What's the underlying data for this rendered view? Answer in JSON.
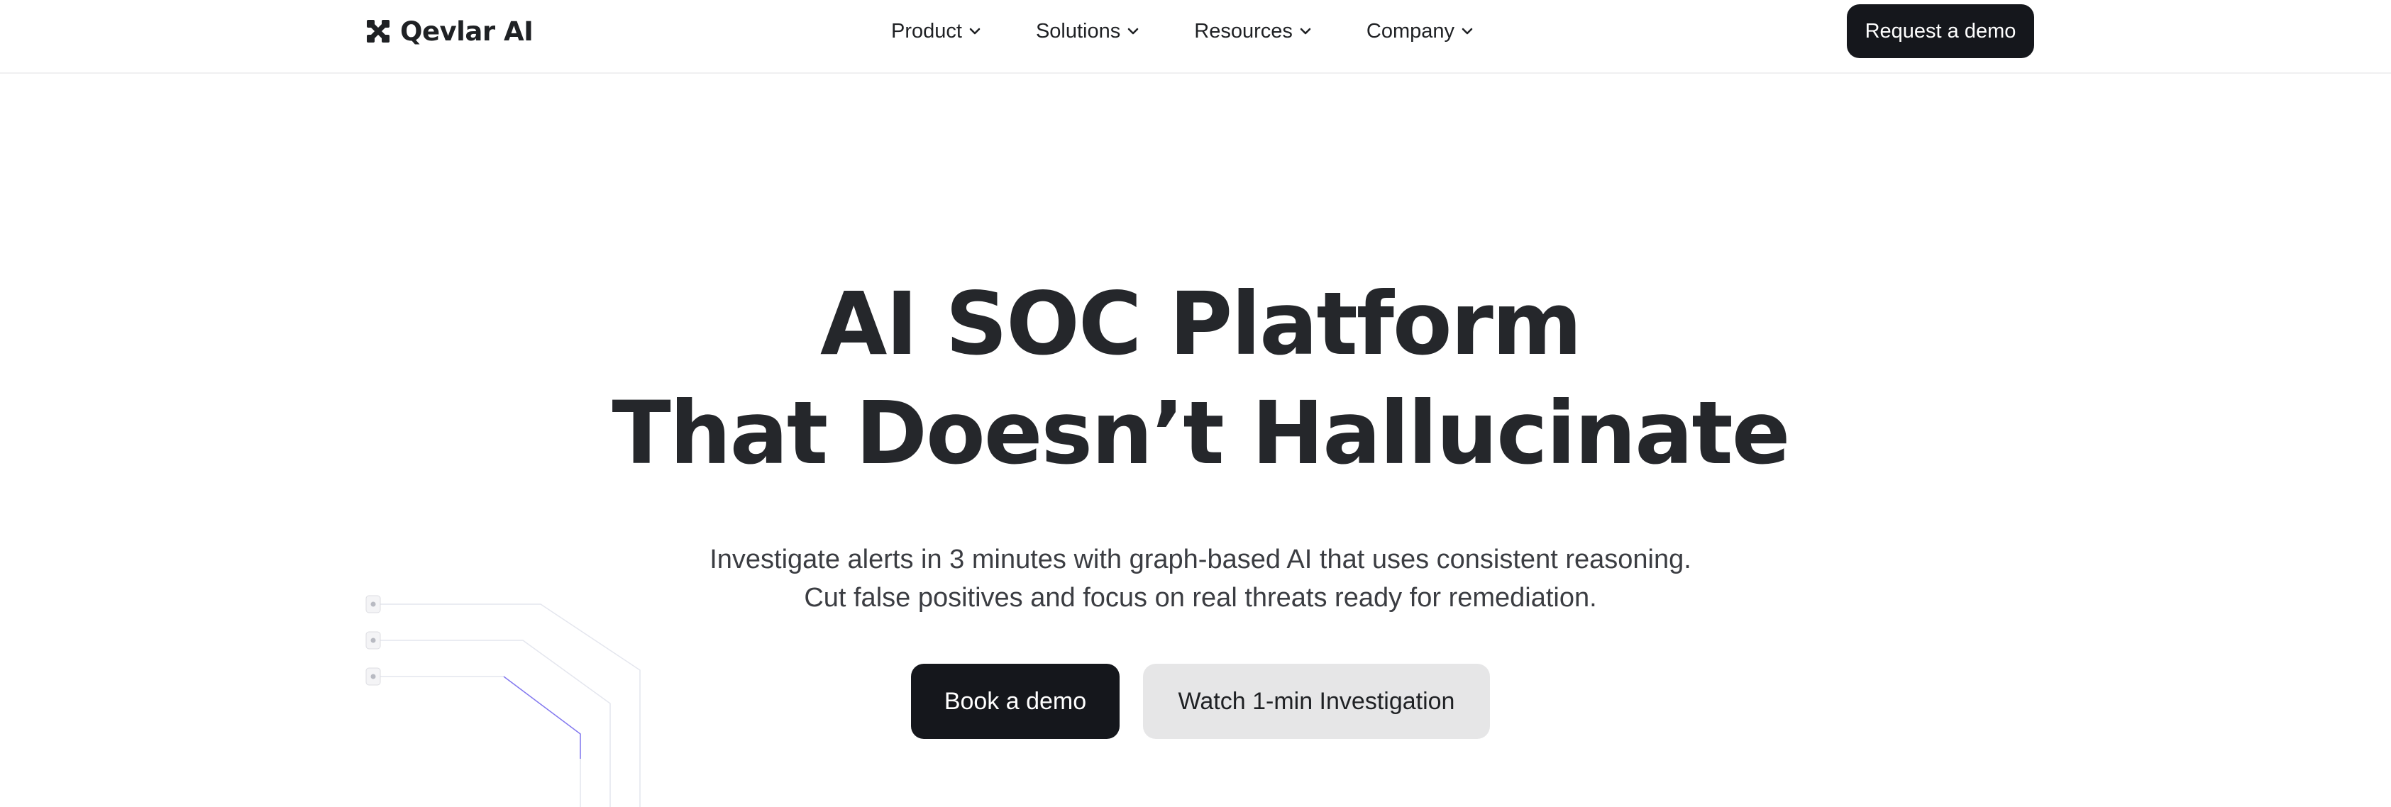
{
  "nav": {
    "brand": "Qevlar AI",
    "menu": [
      {
        "label": "Product"
      },
      {
        "label": "Solutions"
      },
      {
        "label": "Resources"
      },
      {
        "label": "Company"
      }
    ],
    "cta": "Request a demo"
  },
  "hero": {
    "title_line1": "AI SOC Platform",
    "title_line2": "That Doesn’t Hallucinate",
    "subtitle_line1": "Investigate alerts in 3 minutes with graph-based AI that uses consistent reasoning.",
    "subtitle_line2": "Cut false positives and focus on real threats ready for remediation.",
    "primary_button": "Book a demo",
    "secondary_button": "Watch 1-min Investigation"
  },
  "colors": {
    "dark": "#15171c",
    "text": "#25272b",
    "secondary_button_bg": "#e6e6e7",
    "accent_line": "#6a5cf0"
  }
}
